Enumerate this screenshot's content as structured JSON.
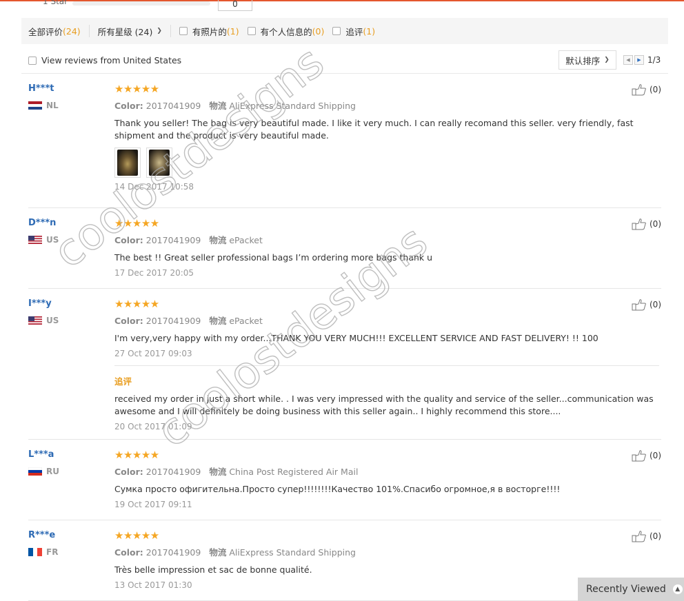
{
  "top_partial": {
    "label": "1 Star",
    "count": "0"
  },
  "filters": {
    "all": {
      "label": "全部评价",
      "count": "(24)"
    },
    "stars": {
      "label": "所有星级 (24)"
    },
    "photos": {
      "label": "有照片的",
      "count": "(1)"
    },
    "personal": {
      "label": "有个人信息的",
      "count": "(0)"
    },
    "followup": {
      "label": "追评",
      "count": "(1)"
    }
  },
  "us_filter": {
    "label": "View reviews from United States"
  },
  "sort": {
    "label": "默认排序"
  },
  "pager": {
    "text": "1/3"
  },
  "reviews": [
    {
      "user": "H***t",
      "country": "NL",
      "stars": "★★★★★",
      "color_label": "Color:",
      "color": "2017041909",
      "ship_label": "物流",
      "shipping": "AliExpress Standard Shipping",
      "text": "Thank you seller! The bag is very beautiful made. I like it very much. I can really recomand this seller. very friendly, fast shipment and the product is very beautiful made.",
      "date": "14 Dec 2017 10:58",
      "likes": "(0)"
    },
    {
      "user": "D***n",
      "country": "US",
      "stars": "★★★★★",
      "color_label": "Color:",
      "color": "2017041909",
      "ship_label": "物流",
      "shipping": "ePacket",
      "text": "The best !! Great seller professional bags I’m ordering more bags thank u",
      "date": "17 Dec 2017 20:05",
      "likes": "(0)"
    },
    {
      "user": "I***y",
      "country": "US",
      "stars": "★★★★★",
      "color_label": "Color:",
      "color": "2017041909",
      "ship_label": "物流",
      "shipping": "ePacket",
      "text": "I'm very,very happy with my order...THANK YOU VERY MUCH!!! EXCELLENT SERVICE AND FAST DELIVERY! !! 100",
      "date": "27 Oct 2017 09:03",
      "likes": "(0)",
      "additional_title": "追评",
      "additional_text": "received my order in just a short while. . I was very impressed with the quality and service of the seller...communication was awesome and I will definitely be doing business with this seller again.. I highly recommend this store....",
      "additional_date": "20 Oct 2017 01:09"
    },
    {
      "user": "L***a",
      "country": "RU",
      "stars": "★★★★★",
      "color_label": "Color:",
      "color": "2017041909",
      "ship_label": "物流",
      "shipping": "China Post Registered Air Mail",
      "text": "Сумка просто офигительна.Просто супер!!!!!!!!Качество 101%.Спасибо огромное,я в восторге!!!!",
      "date": "19 Oct 2017 09:11",
      "likes": "(0)"
    },
    {
      "user": "R***e",
      "country": "FR",
      "stars": "★★★★★",
      "color_label": "Color:",
      "color": "2017041909",
      "ship_label": "物流",
      "shipping": "AliExpress Standard Shipping",
      "text": "Très belle impression et sac de bonne qualité.",
      "date": "13 Oct 2017 01:30",
      "likes": "(0)"
    }
  ],
  "watermark": {
    "text": "coolostdesigns"
  },
  "recently_viewed": {
    "label": "Recently Viewed"
  },
  "colors": {
    "accent": "#e4572e",
    "username": "#2d6ab4",
    "star": "#f5a623",
    "count": "#e89d1f"
  }
}
